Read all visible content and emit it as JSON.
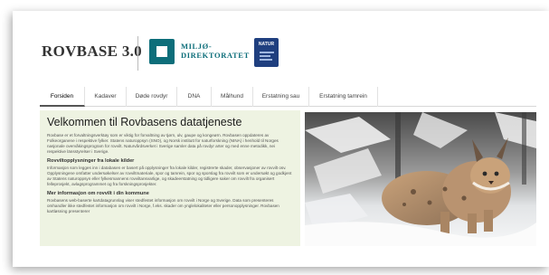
{
  "header": {
    "brand": "ROVBASE 3.0",
    "miljo_line1": "MILJØ-",
    "miljo_line2": "DIREKTORATET",
    "nina_text": "NATUR"
  },
  "nav": {
    "tabs": [
      {
        "label": "Forsiden",
        "active": true
      },
      {
        "label": "Kadaver",
        "active": false
      },
      {
        "label": "Døde rovdyr",
        "active": false
      },
      {
        "label": "DNA",
        "active": false
      },
      {
        "label": "Målhund",
        "active": false
      },
      {
        "label": "Erstatning sau",
        "active": false
      },
      {
        "label": "Erstatning tamrein",
        "active": false
      }
    ]
  },
  "main": {
    "title": "Velkommen til Rovbasens datatjeneste",
    "intro": "Rovbase er et forvaltningsverktøy som er viktig for forvaltning av tjørn, ulv, gaupe og kongeørn. Rovbasen oppdateres av Folkeorganene i respektive fylker. Statens naturoppsyn (SNO), og Norsk institutt for naturforskning (NINA) i henhold til Norges nasjonale overvåkingsprogram for rovvilt. Naturvårdsverket i Sverige samler data på rovdyr arter og med enne metodikk, nei respektive länsstyrelser i Sverige.",
    "section1_title": "Rovviltopplysninger fra lokale kilder",
    "section1_body": "Informasjon som legges inn i databasen er basert på opplysninger fra lokale kilder, registrerte skader, observasjoner av rovvilt osv. Opplysningene omfatter undersøkelser av rovviltmateriale, spor og tamrein, spor og sporslag fra rovvilt som er undersøkt og godkjent av Statens naturoppsyn eller fylkesmannens rovviltansvarlige, og skadeerstatning og tidligere saker om rovvilt fra organisert felleprosjekt, avlagsprogrammet og fra forskningsprosjekter.",
    "section2_title": "Mer informasjon om rovvilt i din kommune",
    "section2_body": "Rovbasens web-baserte kartdatagrunnlag viser stedfestet informasjon om rovvilt i Norge og Sverige. Data som presenteres omhandler ikke stedfestet informasjon om rovvilt i Norge, f.eks. skader om ynglelokaliteter eller personopplysninger. Rovbasen kartløsning presenterer"
  }
}
